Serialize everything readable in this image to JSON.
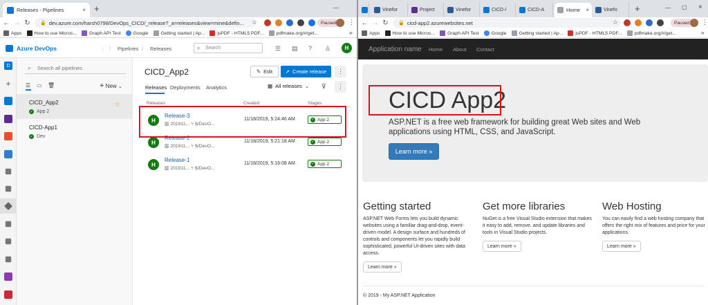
{
  "left_browser": {
    "tab_title": "Releases - Pipelines",
    "tab_close": "×",
    "new_tab": "+",
    "url_main": "dev.azure.com/harsh0798/DevOps_CICD/_release?_a=releases&view=mine&defin...",
    "profile_status": "Paused",
    "bookmarks": [
      "Apps",
      "How to use Micros...",
      "Graph API Test",
      "Google",
      "Getting started | Ap...",
      "jsPDF - HTML5 PDF...",
      "pdfmake.org/#/get..."
    ],
    "more": "»"
  },
  "right_browser": {
    "tabs": [
      "Vinefor",
      "Project",
      "Vinefor",
      "CICD-/",
      "CICD-A",
      "Home",
      "Vinefo"
    ],
    "new_tab": "+",
    "url": "cicd-app2.azurewebsites.net",
    "profile_status": "Paused",
    "bookmarks": [
      "Apps",
      "How to use Micros...",
      "Graph API Test",
      "Google",
      "Getting started | Ap...",
      "jsPDF - HTML5 PDF...",
      "pdfmake.org/#/get..."
    ],
    "more": "»"
  },
  "devops": {
    "brand": "Azure DevOps",
    "breadcrumb": [
      "Pipelines",
      "Releases"
    ],
    "search_placeholder": "Search",
    "user_initial": "H",
    "side_search_placeholder": "Search all pipelines",
    "new_label": "New",
    "pipelines": [
      {
        "name": "CICD_App2",
        "status": "App 2"
      },
      {
        "name": "CICD-App1",
        "status": "Dev"
      }
    ],
    "title": "CICD_App2",
    "edit_label": "Edit",
    "create_label": "Create release",
    "tabs": [
      "Releases",
      "Deployments",
      "Analytics"
    ],
    "filter_label": "All releases",
    "columns": [
      "Releases",
      "Created",
      "Stages"
    ],
    "releases": [
      {
        "name": "Release-3",
        "build": "201911...",
        "branch": "$/DevO...",
        "created": "11/18/2019, 5:24:46 AM",
        "stage": "App 2"
      },
      {
        "name": "Release-2",
        "build": "201911...",
        "branch": "$/DevO...",
        "created": "11/18/2019, 5:21:18 AM",
        "stage": "App 2"
      },
      {
        "name": "Release-1",
        "build": "201911...",
        "branch": "$/DevO...",
        "created": "11/18/2019, 5:16:08 AM",
        "stage": "App 2"
      }
    ]
  },
  "asp": {
    "brand": "Application name",
    "nav": [
      "Home",
      "About",
      "Contact"
    ],
    "title": "CICD App2",
    "lead": "ASP.NET is a free web framework for building great Web sites and Web applications using HTML, CSS, and JavaScript.",
    "learn_more": "Learn more »",
    "columns": [
      {
        "heading": "Getting started",
        "text": "ASP.NET Web Forms lets you build dynamic websites using a familiar drag-and-drop, event-driven model. A design surface and hundreds of controls and components let you rapidly build sophisticated, powerful UI-driven sites with data access.",
        "button": "Learn more »"
      },
      {
        "heading": "Get more libraries",
        "text": "NuGet is a free Visual Studio extension that makes it easy to add, remove, and update libraries and tools in Visual Studio projects.",
        "button": "Learn more »"
      },
      {
        "heading": "Web Hosting",
        "text": "You can easily find a web hosting company that offers the right mix of features and price for your applications.",
        "button": "Learn more »"
      }
    ],
    "footer": "© 2019 - My ASP.NET Application"
  },
  "colors": {
    "azure_blue": "#0078d4",
    "success_green": "#107c10",
    "highlight_red": "#d9131e",
    "bootstrap_blue": "#337ab7"
  }
}
